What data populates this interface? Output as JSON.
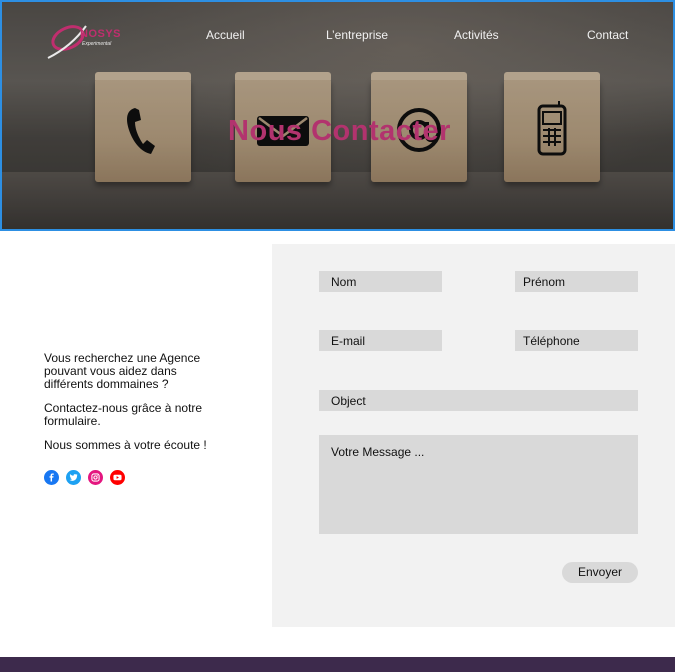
{
  "logo": {
    "brand": "NOSYS",
    "tagline": "Experimental"
  },
  "nav": {
    "items": [
      {
        "label": "Accueil"
      },
      {
        "label": "L’entreprise"
      },
      {
        "label": "Activités"
      },
      {
        "label": "Contact"
      }
    ]
  },
  "hero": {
    "title": "Nous Contacter",
    "cubes": [
      "phone-icon",
      "envelope-icon",
      "at-sign-icon",
      "mobile-phone-icon"
    ]
  },
  "intro": {
    "paragraphs": [
      "Vous recherchez une Agence pouvant vous aidez dans différents dommaines ?",
      "Contactez-nous grâce à notre formulaire.",
      "Nous sommes à votre écoute !"
    ]
  },
  "socials": [
    "facebook-icon",
    "twitter-icon",
    "instagram-icon",
    "youtube-icon"
  ],
  "form": {
    "nom": "Nom",
    "prenom": "Prénom",
    "email": "E-mail",
    "telephone": "Téléphone",
    "object": "Object",
    "message": "Votre Message  ...",
    "submit": "Envoyer"
  },
  "colors": {
    "accent": "#b2336e",
    "hero_border": "#2d8fe3",
    "footer": "#3d2a4c",
    "field_bg": "#d9d9d9",
    "panel_bg": "#f2f2f2"
  }
}
